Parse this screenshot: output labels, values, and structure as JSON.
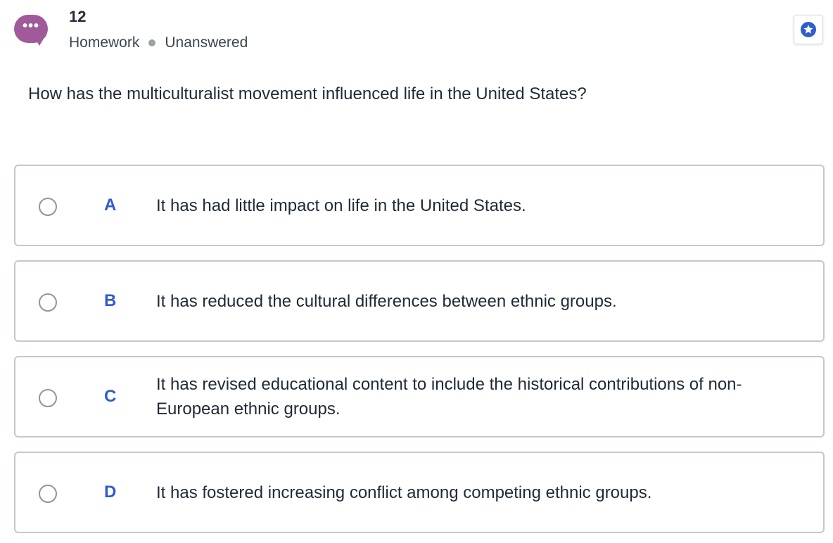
{
  "header": {
    "question_number": "12",
    "category": "Homework",
    "status": "Unanswered",
    "chat_icon": "chat-bubble-icon",
    "bookmark_icon": "star-icon"
  },
  "question": {
    "text": "How has the multiculturalist movement influenced life in the United States?"
  },
  "options": [
    {
      "letter": "A",
      "text": "It has had little impact on life in the United States."
    },
    {
      "letter": "B",
      "text": "It has reduced the cultural differences between ethnic groups."
    },
    {
      "letter": "C",
      "text": "It has revised educational content to include the historical contributions of non-European ethnic groups."
    },
    {
      "letter": "D",
      "text": "It has fostered increasing conflict among competing ethnic groups."
    }
  ],
  "colors": {
    "chat_bubble": "#a05a9a",
    "letter_accent": "#2f5dcc",
    "star": "#2f5dcc",
    "border": "#c3c8ce"
  }
}
